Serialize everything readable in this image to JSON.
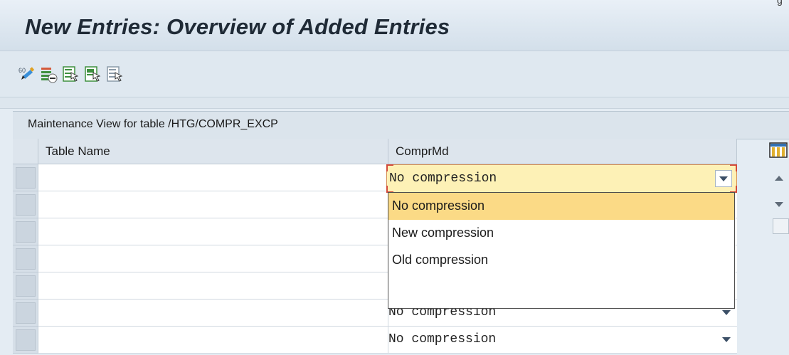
{
  "title": "New Entries: Overview of Added Entries",
  "corner_mark": "g",
  "toolbar": {
    "buttons": [
      {
        "name": "display-change-icon",
        "tooltip": ""
      },
      {
        "name": "delete-icon",
        "tooltip": ""
      },
      {
        "name": "select-all-icon",
        "tooltip": ""
      },
      {
        "name": "select-block-icon",
        "tooltip": ""
      },
      {
        "name": "deselect-all-icon",
        "tooltip": ""
      }
    ]
  },
  "panel": {
    "title": "Maintenance View for table /HTG/COMPR_EXCP"
  },
  "table": {
    "headers": [
      "Table Name",
      "ComprMd"
    ],
    "rows": [
      {
        "table_name": "",
        "compr_md": "No compression"
      },
      {
        "table_name": "",
        "compr_md": ""
      },
      {
        "table_name": "",
        "compr_md": ""
      },
      {
        "table_name": "",
        "compr_md": ""
      },
      {
        "table_name": "",
        "compr_md": ""
      },
      {
        "table_name": "",
        "compr_md": "No compression"
      },
      {
        "table_name": "",
        "compr_md": "No compression"
      }
    ]
  },
  "dropdown": {
    "selected_value": "No compression",
    "options": [
      "No compression",
      "New compression",
      "Old compression"
    ]
  },
  "colors": {
    "accent": "#fbda86",
    "active_cell": "#fdf1b6",
    "title_bar": "#d3dfea"
  }
}
